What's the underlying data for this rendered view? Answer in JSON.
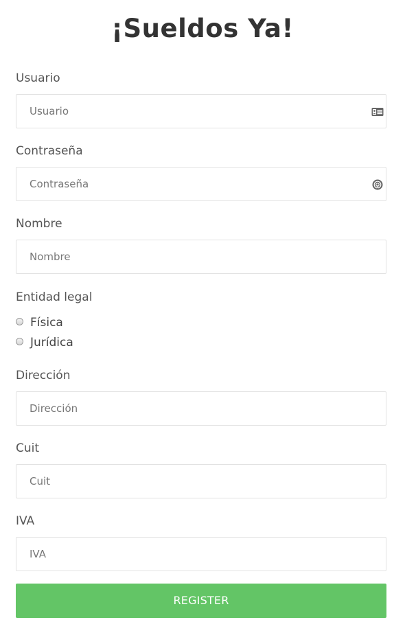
{
  "title": "¡Sueldos Ya!",
  "form": {
    "usuario": {
      "label": "Usuario",
      "placeholder": "Usuario",
      "icon": "id-card-icon"
    },
    "contrasena": {
      "label": "Contraseña",
      "placeholder": "Contraseña",
      "icon": "fingerprint-icon"
    },
    "nombre": {
      "label": "Nombre",
      "placeholder": "Nombre"
    },
    "entidad": {
      "label": "Entidad legal",
      "options": [
        "Física",
        "Jurídica"
      ]
    },
    "direccion": {
      "label": "Dirección",
      "placeholder": "Dirección"
    },
    "cuit": {
      "label": "Cuit",
      "placeholder": "Cuit"
    },
    "iva": {
      "label": "IVA",
      "placeholder": "IVA"
    },
    "register_label": "REGISTER"
  },
  "colors": {
    "button": "#63c566",
    "title": "#333333",
    "label": "#555555",
    "border": "#e2e2e2"
  }
}
